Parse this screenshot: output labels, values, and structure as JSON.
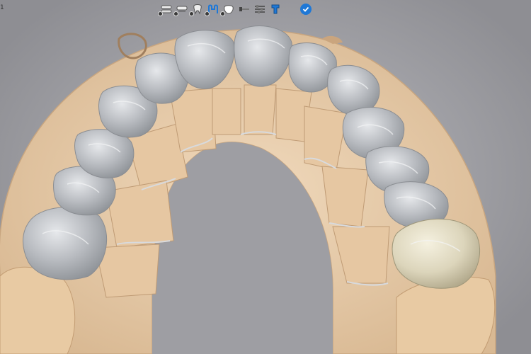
{
  "viewport_edge_label": "1",
  "toolbar": {
    "tools": [
      {
        "name": "jaw-icon",
        "indicator": true
      },
      {
        "name": "arch-icon",
        "indicator": true
      },
      {
        "name": "tooth-icon",
        "indicator": true
      },
      {
        "name": "margin-icon",
        "indicator": true
      },
      {
        "name": "crown-icon",
        "indicator": true
      },
      {
        "name": "connector-icon",
        "indicator": false
      },
      {
        "name": "sliders-icon",
        "indicator": false
      },
      {
        "name": "implant-icon",
        "indicator": false
      }
    ],
    "confirm_icon": "check-circle-icon",
    "accent_color": "#1f78d6"
  },
  "colors": {
    "model": "#ebd1b1",
    "model_shadow": "#c8a57f",
    "crown": "#b9bcc0",
    "crown_highlight": "#e3e5e8",
    "crown_selected": "#e8e2cc",
    "background": "#a6a6ab"
  }
}
